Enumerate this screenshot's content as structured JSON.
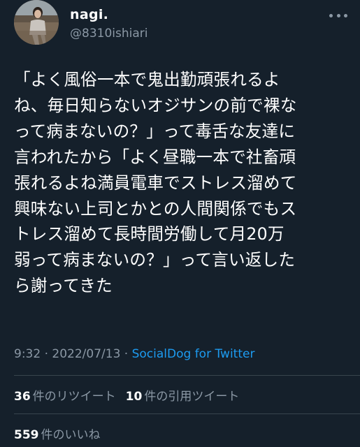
{
  "author": {
    "display_name": "nagi.",
    "handle": "@8310ishiari",
    "avatar_icon": "profile-photo"
  },
  "more_icon": "more-horizontal-icon",
  "tweet": {
    "lines": [
      "「よく風俗一本で鬼出勤頑張れるよ",
      "ね、毎日知らないオジサンの前で裸な",
      "って病まないの？」って毒舌な友達に",
      "言われたから「よく昼職一本で社畜頑",
      "張れるよね満員電車でストレス溜めて",
      "興味ない上司とかとの人間関係でもス",
      "トレス溜めて長時間労働して月20万",
      "弱って病まないの？」って言い返した",
      "ら謝ってきた"
    ]
  },
  "meta": {
    "time": "9:32",
    "separator1": " · ",
    "date": "2022/07/13",
    "separator2": " · ",
    "source": "SocialDog for Twitter"
  },
  "stats": {
    "retweets_count": "36",
    "retweets_label": "件のリツイート",
    "quotes_count": "10",
    "quotes_label": "件の引用ツイート",
    "likes_count": "559",
    "likes_label": "件のいいね"
  },
  "colors": {
    "background": "#15202b",
    "text": "#ffffff",
    "muted": "#8b98a5",
    "link": "#1d9bf0",
    "divider": "#38444d"
  }
}
